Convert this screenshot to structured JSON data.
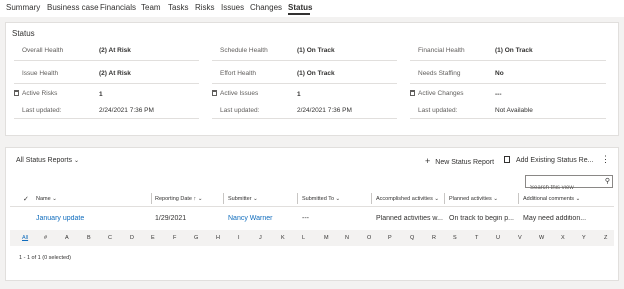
{
  "tabs": [
    {
      "label": "Summary"
    },
    {
      "label": "Business case"
    },
    {
      "label": "Financials"
    },
    {
      "label": "Team"
    },
    {
      "label": "Tasks"
    },
    {
      "label": "Risks"
    },
    {
      "label": "Issues"
    },
    {
      "label": "Changes"
    },
    {
      "label": "Status",
      "active": true
    }
  ],
  "status_section": {
    "title": "Status",
    "overall_health": {
      "label": "Overall Health",
      "value": "(2) At Risk"
    },
    "schedule_health": {
      "label": "Schedule Health",
      "value": "(1) On Track"
    },
    "financial_health": {
      "label": "Financial Health",
      "value": "(1) On Track"
    },
    "issue_health": {
      "label": "Issue Health",
      "value": "(2) At Risk"
    },
    "effort_health": {
      "label": "Effort Health",
      "value": "(1) On Track"
    },
    "needs_staffing": {
      "label": "Needs Staffing",
      "value": "No"
    },
    "active_risks": {
      "label": "Active Risks",
      "value": "1",
      "last_updated_label": "Last updated:",
      "last_updated": "2/24/2021 7:36 PM"
    },
    "active_issues": {
      "label": "Active Issues",
      "value": "1",
      "last_updated_label": "Last updated:",
      "last_updated": "2/24/2021 7:36 PM"
    },
    "active_changes": {
      "label": "Active Changes",
      "value": "---",
      "last_updated_label": "Last updated:",
      "last_updated": "Not Available"
    }
  },
  "reports": {
    "view_selector": "All Status Reports",
    "new_button": "New Status Report",
    "add_existing_button": "Add Existing Status Re...",
    "search_placeholder": "Search this view",
    "columns": [
      "Name",
      "Reporting Date",
      "Submitter",
      "Submitted To",
      "Accomplished activities",
      "Planned activities",
      "Additional comments"
    ],
    "rows": [
      {
        "name": "January update",
        "reporting_date": "1/29/2021",
        "submitter": "Nancy Warner",
        "submitted_to": "---",
        "accomplished": "Planned activities w...",
        "planned": "On track to begin p...",
        "comments": "May need addition..."
      }
    ],
    "alphabet": [
      "All",
      "#",
      "A",
      "B",
      "C",
      "D",
      "E",
      "F",
      "G",
      "H",
      "I",
      "J",
      "K",
      "L",
      "M",
      "N",
      "O",
      "P",
      "Q",
      "R",
      "S",
      "T",
      "U",
      "V",
      "W",
      "X",
      "Y",
      "Z"
    ],
    "active_letter": "All",
    "footer": "1 - 1 of 1 (0 selected)"
  },
  "colors": {
    "accent": "#0f6cbd",
    "text": "#323130",
    "muted": "#605e5c",
    "background": "#f3f2f1"
  }
}
